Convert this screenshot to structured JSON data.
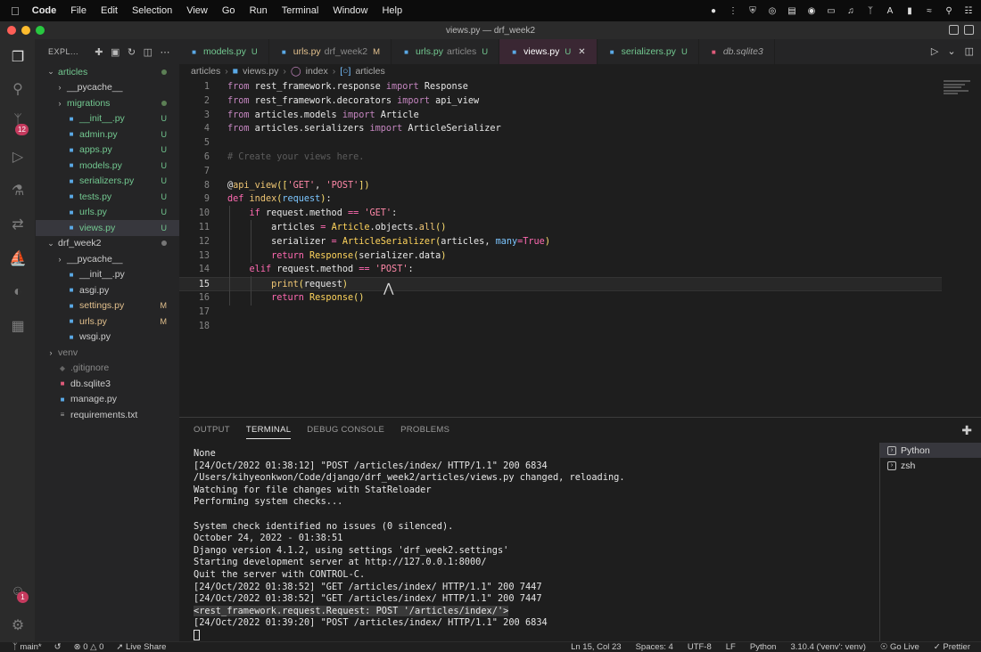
{
  "menubar": {
    "app_name": "Code",
    "items": [
      "File",
      "Edit",
      "Selection",
      "View",
      "Go",
      "Run",
      "Terminal",
      "Window",
      "Help"
    ],
    "status_icons": [
      "record-icon",
      "divider-icon",
      "shield-icon",
      "play-circle-icon",
      "sidebar-icon",
      "chrome-icon",
      "display-icon",
      "volume-icon",
      "bluetooth-icon",
      "input-source-icon",
      "battery-icon",
      "wifi-icon",
      "search-icon",
      "control-center-icon"
    ],
    "input_source": "A"
  },
  "window": {
    "title": "views.py — drf_week2"
  },
  "activity_bar": {
    "items": [
      "files-icon",
      "search-icon",
      "source-control-icon",
      "run-debug-icon",
      "testing-icon",
      "remote-icon",
      "docker-icon",
      "edge-icon",
      "extensions-icon"
    ],
    "scm_badge": "12",
    "account_badge": "1"
  },
  "explorer": {
    "title": "EXPL...",
    "tree": [
      {
        "label": "articles",
        "type": "folder-open",
        "depth": 0,
        "status": "dot",
        "color": "untracked"
      },
      {
        "label": "__pycache__",
        "type": "folder",
        "depth": 1,
        "status": "",
        "color": "plain"
      },
      {
        "label": "migrations",
        "type": "folder",
        "depth": 1,
        "status": "dot",
        "color": "untracked"
      },
      {
        "label": "__init__.py",
        "type": "py",
        "depth": 1,
        "status": "U",
        "color": "untracked"
      },
      {
        "label": "admin.py",
        "type": "py",
        "depth": 1,
        "status": "U",
        "color": "untracked"
      },
      {
        "label": "apps.py",
        "type": "py",
        "depth": 1,
        "status": "U",
        "color": "untracked"
      },
      {
        "label": "models.py",
        "type": "py",
        "depth": 1,
        "status": "U",
        "color": "untracked"
      },
      {
        "label": "serializers.py",
        "type": "py",
        "depth": 1,
        "status": "U",
        "color": "untracked"
      },
      {
        "label": "tests.py",
        "type": "py",
        "depth": 1,
        "status": "U",
        "color": "untracked"
      },
      {
        "label": "urls.py",
        "type": "py",
        "depth": 1,
        "status": "U",
        "color": "untracked"
      },
      {
        "label": "views.py",
        "type": "py",
        "depth": 1,
        "status": "U",
        "color": "untracked",
        "selected": true
      },
      {
        "label": "drf_week2",
        "type": "folder-open",
        "depth": 0,
        "status": "dot-gray",
        "color": "plain"
      },
      {
        "label": "__pycache__",
        "type": "folder",
        "depth": 1,
        "status": "",
        "color": "plain"
      },
      {
        "label": "__init__.py",
        "type": "py",
        "depth": 1,
        "status": "",
        "color": "plain"
      },
      {
        "label": "asgi.py",
        "type": "py",
        "depth": 1,
        "status": "",
        "color": "plain"
      },
      {
        "label": "settings.py",
        "type": "py",
        "depth": 1,
        "status": "M",
        "color": "modified"
      },
      {
        "label": "urls.py",
        "type": "py",
        "depth": 1,
        "status": "M",
        "color": "modified"
      },
      {
        "label": "wsgi.py",
        "type": "py",
        "depth": 1,
        "status": "",
        "color": "plain"
      },
      {
        "label": "venv",
        "type": "folder",
        "depth": 0,
        "status": "",
        "color": "dim"
      },
      {
        "label": ".gitignore",
        "type": "git",
        "depth": 0,
        "status": "",
        "color": "dim"
      },
      {
        "label": "db.sqlite3",
        "type": "db",
        "depth": 0,
        "status": "",
        "color": "plain"
      },
      {
        "label": "manage.py",
        "type": "py",
        "depth": 0,
        "status": "",
        "color": "plain"
      },
      {
        "label": "requirements.txt",
        "type": "txt",
        "depth": 0,
        "status": "",
        "color": "plain"
      }
    ]
  },
  "tabs": [
    {
      "label": "models.py",
      "sub": "",
      "status": "U",
      "icon": "python-icon"
    },
    {
      "label": "urls.py",
      "sub": "drf_week2",
      "status": "M",
      "icon": "python-icon"
    },
    {
      "label": "urls.py",
      "sub": "articles",
      "status": "U",
      "icon": "python-icon"
    },
    {
      "label": "views.py",
      "sub": "",
      "status": "U",
      "icon": "python-icon",
      "active": true
    },
    {
      "label": "serializers.py",
      "sub": "",
      "status": "U",
      "icon": "python-icon"
    },
    {
      "label": "db.sqlite3",
      "sub": "",
      "status": "",
      "icon": "database-icon",
      "italic": true
    }
  ],
  "breadcrumb": [
    "articles",
    "views.py",
    "index",
    "articles"
  ],
  "editor": {
    "current_line": 15,
    "lines": [
      [
        [
          "k",
          "from"
        ],
        [
          "id",
          " rest_framework.response "
        ],
        [
          "k",
          "import"
        ],
        [
          "id",
          " Response"
        ]
      ],
      [
        [
          "k",
          "from"
        ],
        [
          "id",
          " rest_framework.decorators "
        ],
        [
          "k",
          "import"
        ],
        [
          "id",
          " api_view"
        ]
      ],
      [
        [
          "k",
          "from"
        ],
        [
          "id",
          " articles.models "
        ],
        [
          "k",
          "import"
        ],
        [
          "id",
          " Article"
        ]
      ],
      [
        [
          "k",
          "from"
        ],
        [
          "id",
          " articles.serializers "
        ],
        [
          "k",
          "import"
        ],
        [
          "id",
          " ArticleSerializer"
        ]
      ],
      [],
      [
        [
          "cm",
          "# Create your views here."
        ]
      ],
      [],
      [
        [
          "id",
          "@"
        ],
        [
          "fn",
          "api_view"
        ],
        [
          "bl",
          "(["
        ],
        [
          "st",
          "'GET'"
        ],
        [
          "id",
          ", "
        ],
        [
          "st",
          "'POST'"
        ],
        [
          "bl",
          "])"
        ]
      ],
      [
        [
          "kw",
          "def"
        ],
        [
          "id",
          " "
        ],
        [
          "fn",
          "index"
        ],
        [
          "bl",
          "("
        ],
        [
          "pm",
          "request"
        ],
        [
          "bl",
          ")"
        ],
        [
          "id",
          ":"
        ]
      ],
      [
        [
          "id",
          "    "
        ],
        [
          "kw",
          "if"
        ],
        [
          "id",
          " request.method "
        ],
        [
          "kw",
          "=="
        ],
        [
          "id",
          " "
        ],
        [
          "st",
          "'GET'"
        ],
        [
          "id",
          ":"
        ]
      ],
      [
        [
          "id",
          "        articles "
        ],
        [
          "kw",
          "="
        ],
        [
          "id",
          " "
        ],
        [
          "cl",
          "Article"
        ],
        [
          "id",
          ".objects."
        ],
        [
          "fn",
          "all"
        ],
        [
          "bl",
          "()"
        ]
      ],
      [
        [
          "id",
          "        serializer "
        ],
        [
          "kw",
          "="
        ],
        [
          "id",
          " "
        ],
        [
          "cl",
          "ArticleSerializer"
        ],
        [
          "bl",
          "("
        ],
        [
          "id",
          "articles, "
        ],
        [
          "pm",
          "many"
        ],
        [
          "kw",
          "="
        ],
        [
          "kw",
          "True"
        ],
        [
          "bl",
          ")"
        ]
      ],
      [
        [
          "id",
          "        "
        ],
        [
          "kw",
          "return"
        ],
        [
          "id",
          " "
        ],
        [
          "cl",
          "Response"
        ],
        [
          "bl",
          "("
        ],
        [
          "id",
          "serializer.data"
        ],
        [
          "bl",
          ")"
        ]
      ],
      [
        [
          "id",
          "    "
        ],
        [
          "kw",
          "elif"
        ],
        [
          "id",
          " request.method "
        ],
        [
          "kw",
          "=="
        ],
        [
          "id",
          " "
        ],
        [
          "st",
          "'POST'"
        ],
        [
          "id",
          ":"
        ]
      ],
      [
        [
          "id",
          "        "
        ],
        [
          "fn",
          "print"
        ],
        [
          "bl",
          "("
        ],
        [
          "id",
          "request"
        ],
        [
          "bl",
          ")"
        ]
      ],
      [
        [
          "id",
          "        "
        ],
        [
          "kw",
          "return"
        ],
        [
          "id",
          " "
        ],
        [
          "cl",
          "Response"
        ],
        [
          "bl",
          "()"
        ]
      ],
      [],
      []
    ]
  },
  "panel": {
    "tabs": [
      "OUTPUT",
      "TERMINAL",
      "DEBUG CONSOLE",
      "PROBLEMS"
    ],
    "active_tab": "TERMINAL",
    "terminal_lines": [
      "None",
      "[24/Oct/2022 01:38:12] \"POST /articles/index/ HTTP/1.1\" 200 6834",
      "/Users/kihyeonkwon/Code/django/drf_week2/articles/views.py changed, reloading.",
      "Watching for file changes with StatReloader",
      "Performing system checks...",
      "",
      "System check identified no issues (0 silenced).",
      "October 24, 2022 - 01:38:51",
      "Django version 4.1.2, using settings 'drf_week2.settings'",
      "Starting development server at http://127.0.0.1:8000/",
      "Quit the server with CONTROL-C.",
      "[24/Oct/2022 01:38:52] \"GET /articles/index/ HTTP/1.1\" 200 7447",
      "[24/Oct/2022 01:38:52] \"GET /articles/index/ HTTP/1.1\" 200 7447",
      "<rest_framework.request.Request: POST '/articles/index/'>",
      "[24/Oct/2022 01:39:20] \"POST /articles/index/ HTTP/1.1\" 200 6834"
    ],
    "highlighted_line": 13,
    "terminals": [
      "Python",
      "zsh"
    ]
  },
  "statusbar": {
    "left": [
      "main*",
      "0",
      "0",
      "Live Share"
    ],
    "right": [
      "Ln 15, Col 23",
      "Spaces: 4",
      "UTF-8",
      "LF",
      "Python",
      "3.10.4 ('venv': venv)",
      "Go Live",
      "Prettier"
    ]
  },
  "colors": {
    "accent_tab": "#3a2733",
    "badge": "#c53a5e",
    "untracked": "#73c991",
    "modified": "#e2c08d"
  }
}
